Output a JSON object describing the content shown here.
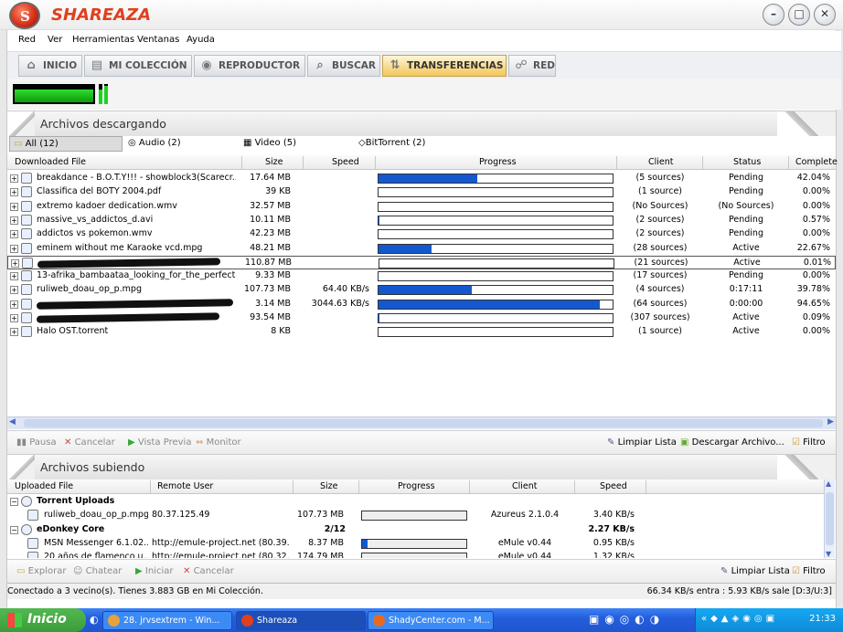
{
  "app": {
    "title": "SHAREAZA",
    "logo_letter": "S"
  },
  "window_controls": {
    "minimize": "–",
    "maximize": "□",
    "close": "✕"
  },
  "menu": [
    "Red",
    "Ver",
    "Herramientas",
    "Ventanas",
    "Ayuda"
  ],
  "nav": [
    {
      "label": "INICIO",
      "icon": "home-icon"
    },
    {
      "label": "MI COLECCIÓN",
      "icon": "library-icon"
    },
    {
      "label": "REPRODUCTOR",
      "icon": "media-player-icon"
    },
    {
      "label": "BUSCAR",
      "icon": "search-icon"
    },
    {
      "label": "TRANSFERENCIAS",
      "icon": "transfers-icon",
      "active": true
    },
    {
      "label": "RED",
      "icon": "network-icon"
    }
  ],
  "downloads": {
    "title": "Archivos descargando",
    "filters": [
      "All (12)",
      "Audio (2)",
      "Video (5)",
      "BitTorrent (2)"
    ],
    "columns": [
      "Downloaded File",
      "Size",
      "Speed",
      "Progress",
      "Client",
      "Status",
      "Complete"
    ],
    "rows": [
      {
        "name": "breakdance - B.O.T.Y!!! - showblock3(Scarecr...",
        "size": "17.64 MB",
        "speed": "",
        "progress": 0.42,
        "client": "(5 sources)",
        "status": "Pending",
        "complete": "42.04%"
      },
      {
        "name": "Classifica del BOTY 2004.pdf",
        "size": "39 KB",
        "speed": "",
        "progress": 0.0,
        "client": "(1 source)",
        "status": "Pending",
        "complete": "0.00%"
      },
      {
        "name": "extremo kadoer dedication.wmv",
        "size": "32.57 MB",
        "speed": "",
        "progress": 0.0,
        "client": "(No Sources)",
        "status": "(No Sources)",
        "complete": "0.00%"
      },
      {
        "name": "massive_vs_addictos_d.avi",
        "size": "10.11 MB",
        "speed": "",
        "progress": 0.0057,
        "client": "(2 sources)",
        "status": "Pending",
        "complete": "0.57%"
      },
      {
        "name": "addictos vs pokemon.wmv",
        "size": "42.23 MB",
        "speed": "",
        "progress": 0.0,
        "client": "(2 sources)",
        "status": "Pending",
        "complete": "0.00%"
      },
      {
        "name": "eminem without me Karaoke vcd.mpg",
        "size": "48.21 MB",
        "speed": "",
        "progress": 0.2267,
        "client": "(28 sources)",
        "status": "Active",
        "complete": "22.67%"
      },
      {
        "name": "",
        "size": "110.87 MB",
        "speed": "",
        "progress": 0.0001,
        "client": "(21 sources)",
        "status": "Active",
        "complete": "0.01%"
      },
      {
        "name": "13-afrika_bambaataa_looking_for_the_perfect...",
        "size": "9.33 MB",
        "speed": "",
        "progress": 0.0,
        "client": "(17 sources)",
        "status": "Pending",
        "complete": "0.00%"
      },
      {
        "name": "ruliweb_doau_op_p.mpg",
        "size": "107.73 MB",
        "speed": "64.40 KB/s",
        "progress": 0.3978,
        "client": "(4 sources)",
        "status": "0:17:11",
        "complete": "39.78%"
      },
      {
        "name": "",
        "size": "3.14 MB",
        "speed": "3044.63 KB/s",
        "progress": 0.9465,
        "client": "(64 sources)",
        "status": "0:00:00",
        "complete": "94.65%"
      },
      {
        "name": "",
        "size": "93.54 MB",
        "speed": "",
        "progress": 0.0009,
        "client": "(307 sources)",
        "status": "Active",
        "complete": "0.09%"
      },
      {
        "name": "Halo OST.torrent",
        "size": "8 KB",
        "speed": "",
        "progress": 0.0,
        "client": "(1 source)",
        "status": "Active",
        "complete": "0.00%"
      }
    ],
    "toolbar": {
      "pause": "Pausa",
      "cancel": "Cancelar",
      "preview": "Vista Previa",
      "monitor": "Monitor",
      "clear": "Limpiar Lista",
      "download_file": "Descargar Archivo...",
      "filter": "Filtro"
    }
  },
  "uploads": {
    "title": "Archivos subiendo",
    "columns": [
      "Uploaded File",
      "Remote User",
      "Size",
      "Progress",
      "Client",
      "Speed"
    ],
    "groups": [
      {
        "name": "Torrent Uploads",
        "size": "",
        "speed": "",
        "items": [
          {
            "name": "ruliweb_doau_op_p.mpg",
            "user": "80.37.125.49",
            "size": "107.73 MB",
            "progress": 0.0,
            "client": "Azureus 2.1.0.4",
            "speed": "3.40 KB/s"
          }
        ]
      },
      {
        "name": "eDonkey Core",
        "size": "2/12",
        "speed": "2.27 KB/s",
        "items": [
          {
            "name": "MSN Messenger 6.1.02...",
            "user": "http://emule-project.net (80.39....",
            "size": "8.37 MB",
            "progress": 0.05,
            "client": "eMule v0.44",
            "speed": "0.95 KB/s"
          },
          {
            "name": "20 años de flamenco.u...",
            "user": "http://emule-project.net (80.32....",
            "size": "174.79 MB",
            "progress": 0.0,
            "client": "eMule v0.44",
            "speed": "1.32 KB/s"
          }
        ]
      }
    ],
    "toolbar": {
      "explore": "Explorar",
      "chat": "Chatear",
      "start": "Iniciar",
      "cancel": "Cancelar",
      "clear": "Limpiar Lista",
      "filter": "Filtro"
    }
  },
  "status": {
    "left": "Conectado a 3 vecino(s). Tienes 3.883 GB en Mi Colección.",
    "right": "66.34 KB/s entra : 5.93 KB/s sale [D:3/U:3]"
  },
  "taskbar": {
    "start": "Inicio",
    "tasks": [
      "28. jrvsextrem - Win...",
      "Shareaza",
      "ShadyCenter.com - M..."
    ],
    "clock": "21:33"
  },
  "colors": {
    "accent": "#e0401e",
    "progress": "#1458d0",
    "taskbar": "#245edb"
  }
}
